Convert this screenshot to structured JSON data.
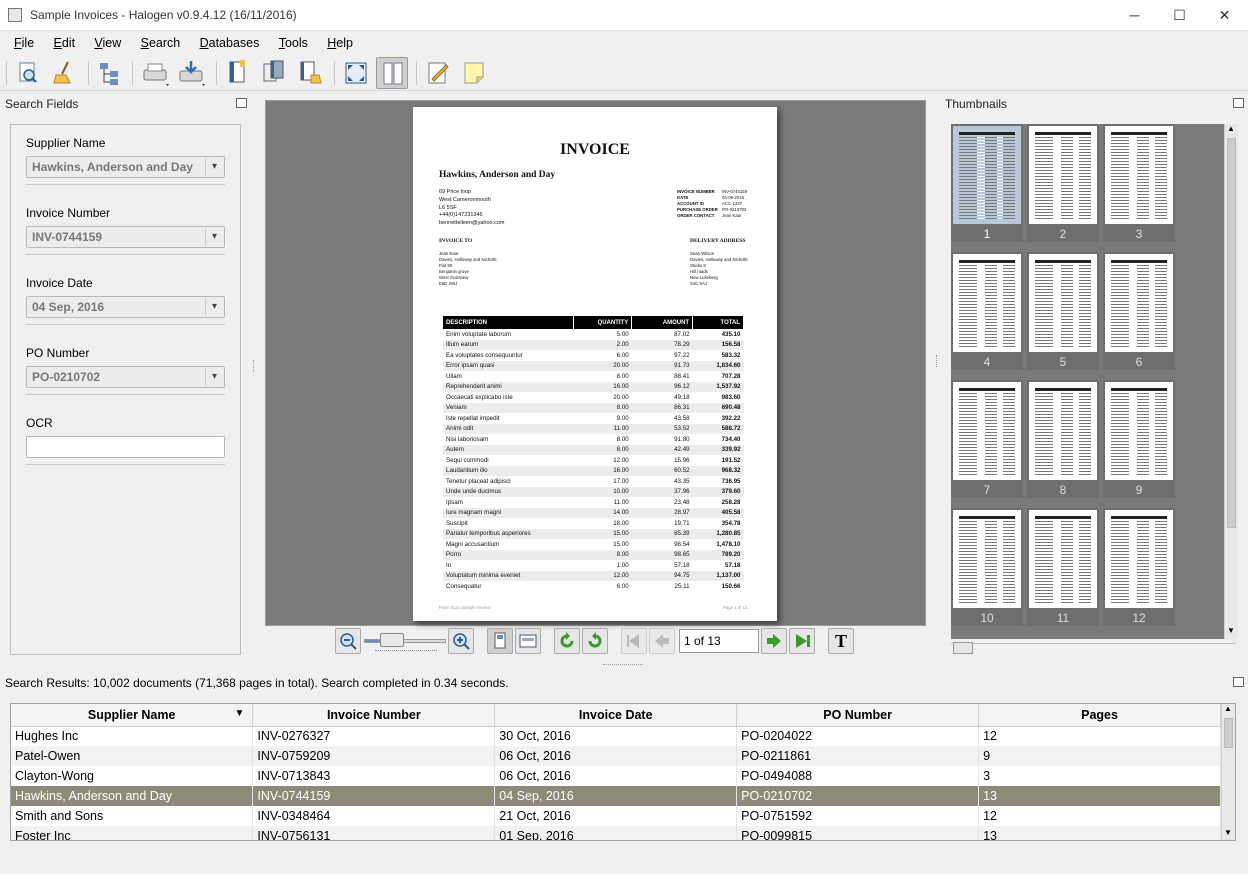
{
  "window": {
    "title": "Sample Invoices - Halogen v0.9.4.12 (16/11/2016)",
    "minimize": "─",
    "maximize": "☐",
    "close": "✕"
  },
  "menu": [
    {
      "key": "F",
      "rest": "ile"
    },
    {
      "key": "E",
      "rest": "dit"
    },
    {
      "key": "V",
      "rest": "iew"
    },
    {
      "key": "S",
      "rest": "earch"
    },
    {
      "key": "D",
      "rest": "atabases"
    },
    {
      "key": "T",
      "rest": "ools"
    },
    {
      "key": "H",
      "rest": "elp"
    }
  ],
  "search_panel": {
    "title": "Search Fields",
    "supplier_label": "Supplier Name",
    "supplier_value": "Hawkins, Anderson and Day",
    "invoice_label": "Invoice Number",
    "invoice_value": "INV-0744159",
    "date_label": "Invoice Date",
    "date_value": "04 Sep, 2016",
    "po_label": "PO Number",
    "po_value": "PO-0210702",
    "ocr_label": "OCR",
    "ocr_value": ""
  },
  "invoice": {
    "heading": "INVOICE",
    "supplier": "Hawkins, Anderson and Day",
    "address": [
      "69 Price loop",
      "West Cameronmouth",
      "L6 5SF",
      "+44(0)147231346",
      "bennetteileen@yahoo.com"
    ],
    "meta_labels": [
      "INVOICE NUMBER",
      "DATE",
      "ACCOUNT ID",
      "PURCHASE ORDER",
      "ORDER CONTACT"
    ],
    "meta_values": [
      "INV-0744159",
      "04-09-2016",
      "ACC-1337",
      "PO-0210702",
      "Jean Kaur"
    ],
    "invoice_to_label": "INVOICE TO",
    "invoice_to": [
      "Jean Kaur",
      "Davies, Holloway and Nicholls",
      "Flat 90",
      "Benjamin grove",
      "West Scottview",
      "E6D 2WJ"
    ],
    "delivery_label": "DELIVERY ADDRESS",
    "delivery": [
      "Sean Wilson",
      "Davies, Holloway and Nicholls",
      "Studio 8",
      "Hill roads",
      "New Lukeberg",
      "S4C 5AJ"
    ],
    "columns": [
      "DESCRIPTION",
      "QUANTITY",
      "AMOUNT",
      "TOTAL"
    ],
    "rows": [
      [
        "Enim voluptate laborum",
        "5.00",
        "87.02",
        "435.10"
      ],
      [
        "Illum earum",
        "2.00",
        "78.29",
        "156.58"
      ],
      [
        "Ea voluptates consequuntur",
        "6.00",
        "97.22",
        "583.32"
      ],
      [
        "Error ipsam quasi",
        "20.00",
        "91.73",
        "1,834.60"
      ],
      [
        "Ullam",
        "8.00",
        "88.41",
        "707.28"
      ],
      [
        "Reprehenderit animi",
        "16.00",
        "96.12",
        "1,537.92"
      ],
      [
        "Occaecati explicabo iste",
        "20.00",
        "49.18",
        "983.60"
      ],
      [
        "Veniam",
        "8.00",
        "86.31",
        "690.48"
      ],
      [
        "Iste repellat impedit",
        "9.00",
        "43.58",
        "392.22"
      ],
      [
        "Animi odit",
        "11.00",
        "53.52",
        "588.72"
      ],
      [
        "Nisi laboriosam",
        "8.00",
        "91.80",
        "734.40"
      ],
      [
        "Autem",
        "8.00",
        "42.49",
        "339.92"
      ],
      [
        "Sequi commodi",
        "12.00",
        "15.96",
        "191.52"
      ],
      [
        "Laudantium illo",
        "16.00",
        "60.52",
        "968.32"
      ],
      [
        "Tenetur placeat adipisci",
        "17.00",
        "43.35",
        "736.95"
      ],
      [
        "Unde unde ducimus",
        "10.00",
        "37.96",
        "379.60"
      ],
      [
        "Ipsam",
        "11.00",
        "23.48",
        "258.28"
      ],
      [
        "Iure magnam magni",
        "14.00",
        "28.97",
        "405.58"
      ],
      [
        "Suscipit",
        "18.00",
        "19.71",
        "354.78"
      ],
      [
        "Pariatur temporibus asperiores",
        "15.00",
        "85.39",
        "1,280.85"
      ],
      [
        "Magni accusantium",
        "15.00",
        "98.54",
        "1,478.10"
      ],
      [
        "Porro",
        "8.00",
        "98.65",
        "789.20"
      ],
      [
        "In",
        "1.00",
        "57.18",
        "57.18"
      ],
      [
        "Voluptatum minima eveniet",
        "12.00",
        "94.75",
        "1,137.00"
      ],
      [
        "Consequatur",
        "6.00",
        "25.11",
        "150.66"
      ]
    ],
    "footer_left": "Pearl Scan Sample Invoice",
    "footer_right": "Page 1 of 13"
  },
  "navigation": {
    "page_field": "1 of 13",
    "text_btn": "T",
    "zoom_level": 0.2
  },
  "thumbnails": {
    "title": "Thumbnails",
    "pages": [
      "1",
      "2",
      "3",
      "4",
      "5",
      "6",
      "7",
      "8",
      "9",
      "10",
      "11",
      "12"
    ],
    "selected": "1"
  },
  "results": {
    "status": "Search Results: 10,002 documents (71,368 pages in total). Search completed in 0.34 seconds.",
    "columns": [
      "Supplier Name",
      "Invoice Number",
      "Invoice Date",
      "PO Number",
      "Pages"
    ],
    "sort_icon": "sort-descending-icon",
    "rows": [
      [
        "Hughes Inc",
        "INV-0276327",
        "30 Oct, 2016",
        "PO-0204022",
        "12"
      ],
      [
        "Patel-Owen",
        "INV-0759209",
        "06 Oct, 2016",
        "PO-0211861",
        "9"
      ],
      [
        "Clayton-Wong",
        "INV-0713843",
        "06 Oct, 2016",
        "PO-0494088",
        "3"
      ],
      [
        "Hawkins, Anderson and Day",
        "INV-0744159",
        "04 Sep, 2016",
        "PO-0210702",
        "13"
      ],
      [
        "Smith and Sons",
        "INV-0348464",
        "21 Oct, 2016",
        "PO-0751592",
        "12"
      ],
      [
        "Foster Inc",
        "INV-0756131",
        "01 Sep, 2016",
        "PO-0099815",
        "13"
      ]
    ],
    "selected_index": 3
  },
  "colors": {
    "selection": "#8b8b78",
    "viewer_bg": "#7a7a7a",
    "thumb_selected": "#b9c8d8"
  }
}
